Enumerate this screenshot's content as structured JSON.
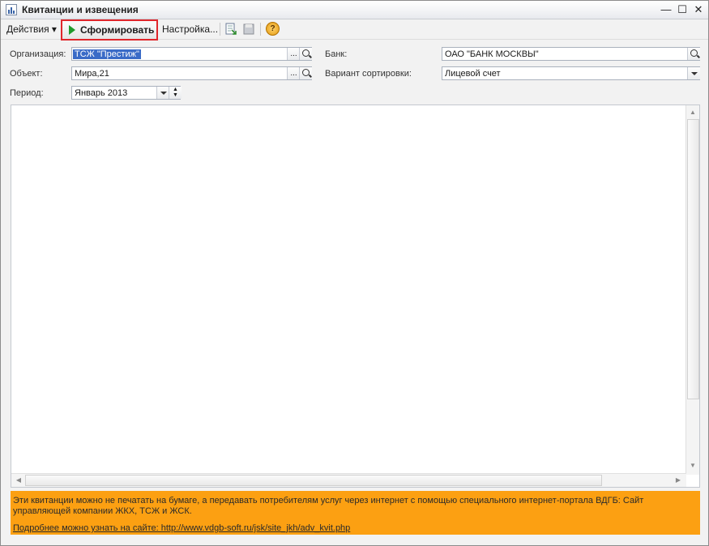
{
  "window": {
    "title": "Квитанции и извещения",
    "minimize": "—",
    "maximize": "☐",
    "close": "✕"
  },
  "toolbar": {
    "actions_label": "Действия ▾",
    "generate_label": "Сформировать",
    "settings_label": "Настройка...",
    "help_label": "?"
  },
  "form": {
    "organization": {
      "label": "Организация:",
      "value": "ТСЖ \"Престиж\"",
      "dots": "..."
    },
    "object": {
      "label": "Объект:",
      "value": "Мира,21",
      "dots": "..."
    },
    "period": {
      "label": "Период:",
      "value": "Январь 2013"
    },
    "bank": {
      "label": "Банк:",
      "value": "ОАО \"БАНК МОСКВЫ\""
    },
    "sort": {
      "label": "Вариант сортировки:",
      "value": "Лицевой счет"
    }
  },
  "info": {
    "text": "Эти квитанции можно не печатать на бумаге, а передавать потребителям услуг через интернет с помощью специального интернет-портала ВДГБ: Сайт управляющей компании ЖКХ, ТСЖ и ЖСК.",
    "link": "Подробнее можно узнать на сайте: http://www.vdgb-soft.ru/jsk/site_jkh/adv_kvit.php"
  },
  "colors": {
    "info_bg": "#fca012",
    "highlight_border": "#e0262b",
    "play_icon": "#1f9a2b",
    "selection": "#3a6bc7"
  }
}
